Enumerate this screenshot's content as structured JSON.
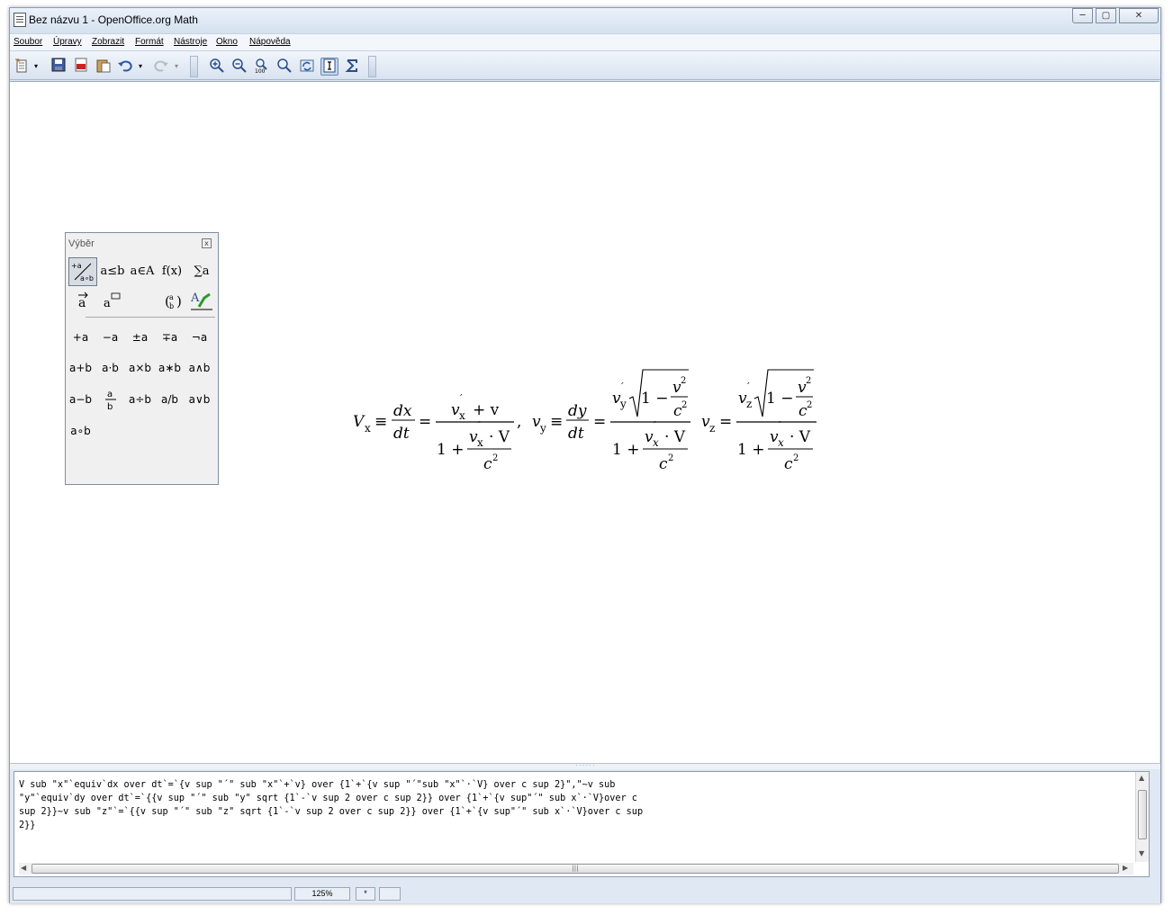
{
  "window": {
    "title": "Bez názvu 1 - OpenOffice.org Math",
    "minimize": "─",
    "maximize": "▢",
    "close": "✕"
  },
  "menu": [
    "Soubor",
    "Úpravy",
    "Zobrazit",
    "Formát",
    "Nástroje",
    "Okno",
    "Nápověda"
  ],
  "toolbar": {
    "icons": [
      "new-document",
      "save",
      "export-pdf",
      "paste",
      "undo",
      "redo",
      "zoom-in",
      "zoom-out",
      "zoom-100",
      "show-all",
      "update",
      "formula-cursor",
      "symbols"
    ]
  },
  "selection_panel": {
    "title": "Výběr",
    "close": "x",
    "categories_row1": [
      "+a a∘b",
      "a≤b",
      "a∈A",
      "f(x)",
      "∑a"
    ],
    "categories_row2": [
      "a⃗",
      "aᵃ",
      "(a b)",
      "A"
    ],
    "symbols": [
      [
        "+a",
        "−a",
        "±a",
        "∓a",
        "¬a"
      ],
      [
        "a+b",
        "a·b",
        "a×b",
        "a∗b",
        "a∧b"
      ],
      [
        "a−b",
        "a/b frac",
        "a÷b",
        "a/b",
        "a∨b"
      ],
      [
        "a∘b"
      ]
    ]
  },
  "formula": {
    "Vx": "V",
    "Vx_sub": "x",
    "equiv": "≡",
    "dx": "dx",
    "dt": "dt",
    "eq": "=",
    "v": "v",
    "prime": "´",
    "plus_v": "+ v",
    "one_plus": "1 +",
    "dot_V": "· V",
    "c": "c",
    "two": "2",
    "comma": ",",
    "dy": "dy",
    "y": "y",
    "x": "x",
    "z": "z",
    "sqrt_body": "1 −"
  },
  "command_text": [
    "V sub \"x\"`equiv`dx over dt`=`{v sup \"´\" sub \"x\"`+`v} over {1`+`{v sup \"´\"sub \"x\"`·`V} over c sup 2}\",\"~v sub",
    "\"y\"`equiv`dy over dt`=`{{v sup \"´\" sub \"y\" sqrt {1`-`v sup 2 over c sup 2}} over {1`+`{v sup\"´\" sub x`·`V}over c",
    "sup 2}}~v sub \"z\"`=`{{v sup \"´\" sub \"z\" sqrt {1`-`v sup 2 over c sup 2}} over {1`+`{v sup\"´\" sub x`·`V}over c sup",
    "2}}"
  ],
  "status": {
    "zoom": "125%",
    "modified": "*"
  }
}
